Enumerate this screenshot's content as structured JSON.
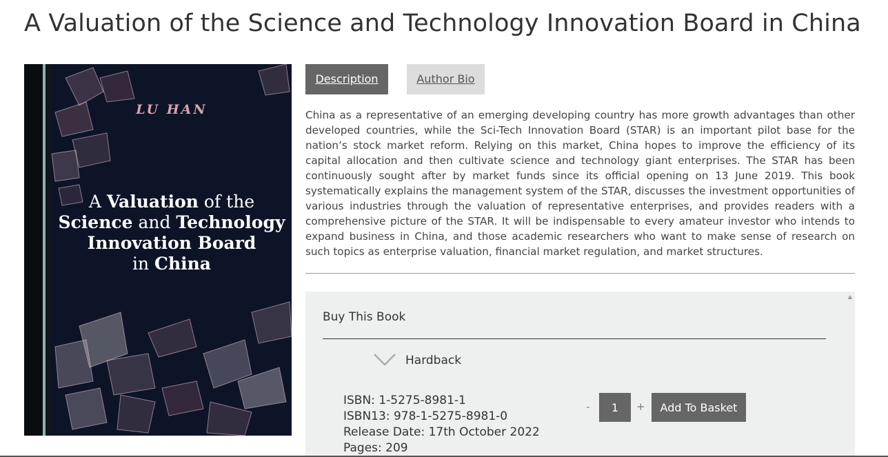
{
  "page": {
    "title": "A Valuation of the Science and Technology Innovation Board in China"
  },
  "cover": {
    "author": "LU HAN",
    "title_parts": {
      "a": "A ",
      "valuation": "Valuation",
      "of_the": " of the",
      "science": "Science",
      "and": " and ",
      "technology": "Technology",
      "innovation_board": "Innovation Board",
      "in": "in ",
      "china": "China"
    },
    "colors": {
      "background": "#0d1428",
      "author": "#d7a3ae",
      "title": "#ffffff"
    }
  },
  "tabs": {
    "description": "Description",
    "author_bio": "Author Bio"
  },
  "description": "China as a representative of an emerging developing country has more growth advantages than other developed countries, while the Sci-Tech Innovation Board (STAR) is an important pilot base for the nation’s stock market reform. Relying on this market, China hopes to improve the efficiency of its capital allocation and then cultivate science and technology giant enterprises. The STAR has been continuously sought after by market funds since its official opening on 13 June 2019. This book systematically explains the management system of the STAR, discusses the investment opportunities of various industries through the valuation of representative enterprises, and provides readers with a comprehensive picture of the STAR. It will be indispensable to every amateur investor who intends to expand business in China, and those academic researchers who want to make sense of research on such topics as enterprise valuation, financial market regulation, and market structures.",
  "buy": {
    "title": "Buy This Book",
    "format": "Hardback",
    "toggle_icon": "chevron-down-icon",
    "scroll_icon": "arrow-up-icon",
    "details": [
      "ISBN: 1-5275-8981-1",
      "ISBN13: 978-1-5275-8981-0",
      "Release Date: 17th October 2022",
      "Pages: 209"
    ],
    "qty_minus": "-",
    "qty_plus": "+",
    "quantity": "1",
    "add_label": "Add To Basket"
  },
  "colors": {
    "active_tab": "#666666",
    "inactive_tab": "#dcdcdc",
    "panel_bg": "#eef0ef",
    "button": "#666666"
  }
}
